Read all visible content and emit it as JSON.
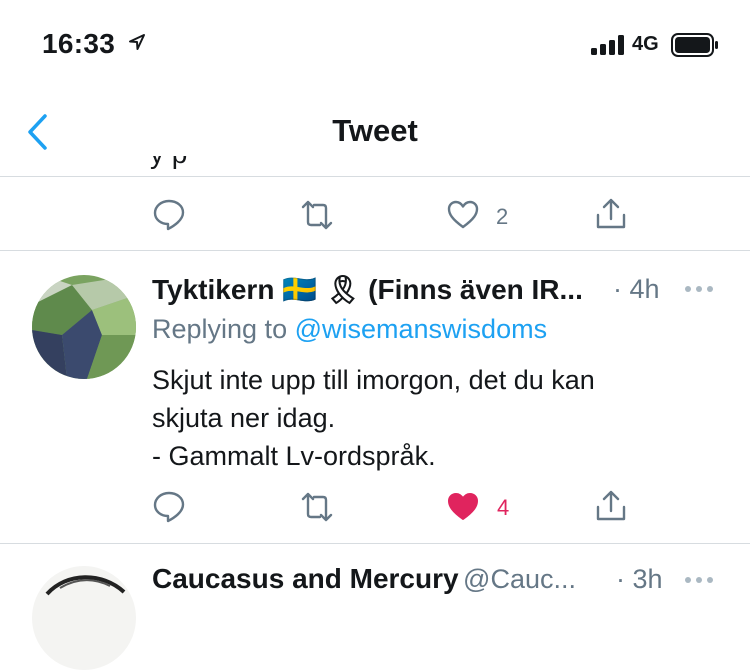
{
  "status_bar": {
    "time": "16:33",
    "network": "4G",
    "icons": [
      "location-arrow-icon",
      "signal-bars-icon",
      "battery-icon"
    ]
  },
  "nav": {
    "title": "Tweet",
    "back_icon": "chevron-left-icon"
  },
  "colors": {
    "accent": "#1da1f2",
    "like": "#e0245e",
    "muted": "#657786",
    "text": "#14171a",
    "divider": "#d7dce0"
  },
  "previous_tweet": {
    "partial_text": "y                          p",
    "actions": {
      "like_count": "2"
    }
  },
  "tweet": {
    "name": "Tyktikern 🇸🇪 🎗 (Finns även IR...",
    "time": "· 4h",
    "replying_prefix": "Replying to",
    "replying_handle": "@wisemanswisdoms",
    "lines": [
      "Skjut inte upp till imorgon, det du kan",
      "skjuta ner idag.",
      "- Gammalt Lv-ordspråk."
    ],
    "actions": {
      "like_count": "4",
      "liked": true
    }
  },
  "next_tweet": {
    "name": "Caucasus and Mercury",
    "handle": "@Cauc...",
    "time": "· 3h"
  }
}
